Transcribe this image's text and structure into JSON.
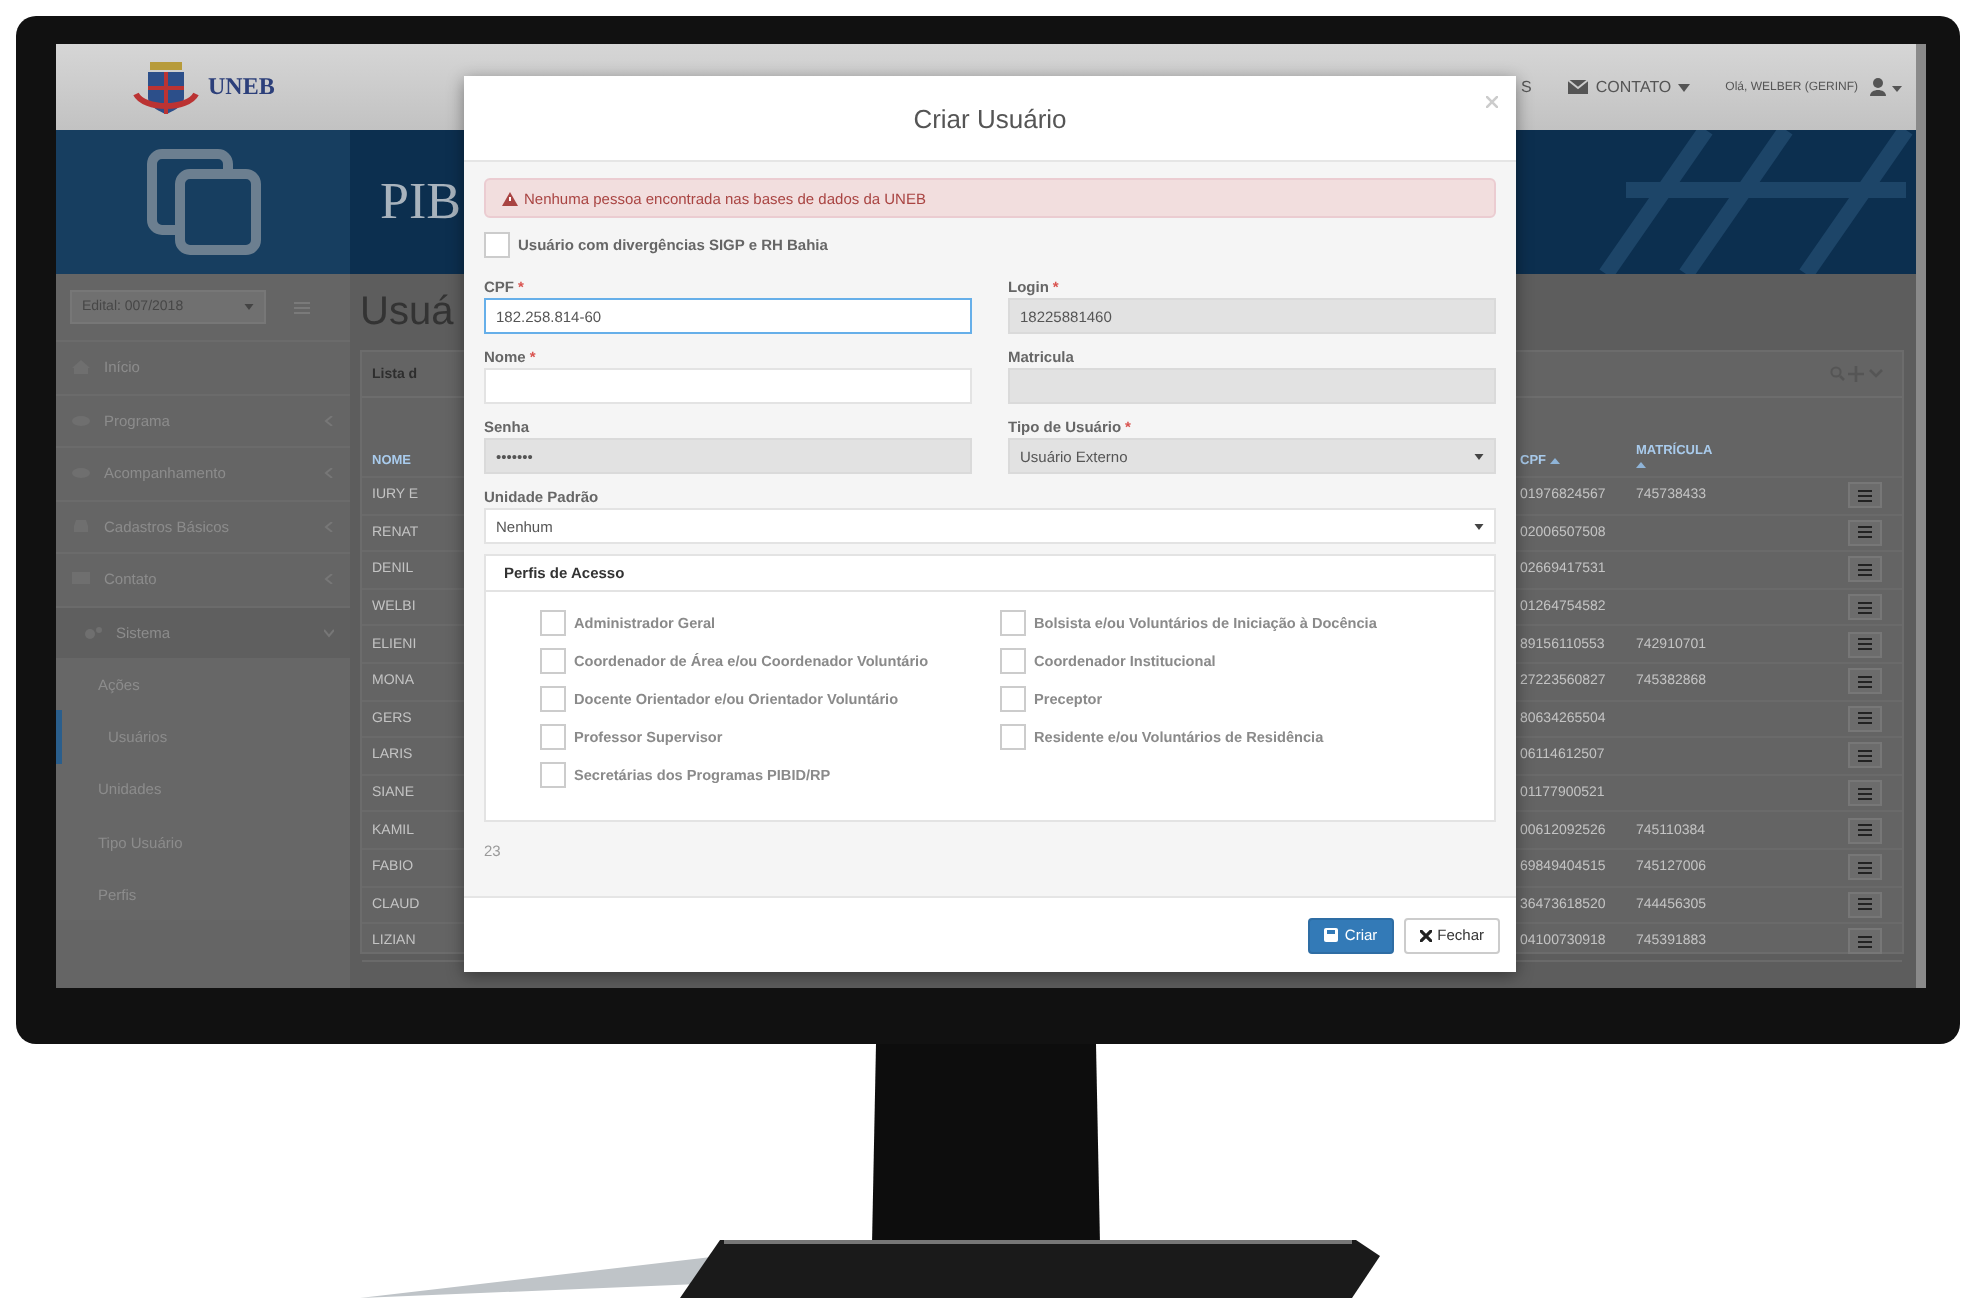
{
  "header": {
    "logo_text": "UNEB",
    "nav": [
      {
        "label": "S",
        "caret": false
      },
      {
        "label": "CONTATO",
        "caret": true
      }
    ],
    "user_greeting": "Olá, WELBER (GERINF)"
  },
  "banner": {
    "title": "PIB"
  },
  "sidebar": {
    "edital": "Edital: 007/2018",
    "items": [
      {
        "label": "Início",
        "kind": "link"
      },
      {
        "label": "Programa",
        "kind": "menu",
        "expanded": false
      },
      {
        "label": "Acompanhamento",
        "kind": "menu",
        "expanded": false
      },
      {
        "label": "Cadastros Básicos",
        "kind": "menu",
        "expanded": false
      },
      {
        "label": "Contato",
        "kind": "menu",
        "expanded": false
      },
      {
        "label": "Sistema",
        "kind": "menu",
        "expanded": true,
        "children": [
          {
            "label": "Ações",
            "selected": false
          },
          {
            "label": "Usuários",
            "selected": true
          },
          {
            "label": "Unidades",
            "selected": false
          },
          {
            "label": "Tipo Usuário",
            "selected": false
          },
          {
            "label": "Perfis",
            "selected": false
          }
        ]
      }
    ]
  },
  "main": {
    "title": "Usuá",
    "panel_title": "Lista d",
    "columns": [
      {
        "label": "NOME",
        "sortable": false
      },
      {
        "label": "CPF",
        "sortable": true
      },
      {
        "label": "MATRÍCULA",
        "sortable": true
      }
    ],
    "rows": [
      {
        "nome": "IURY E",
        "cpf": "01976824567",
        "matricula": "745738433"
      },
      {
        "nome": "RENAT",
        "cpf": "02006507508"
      },
      {
        "nome": "DENIL",
        "cpf": "02669417531"
      },
      {
        "nome": "WELBI",
        "cpf": "01264754582"
      },
      {
        "nome": "ELIENI",
        "cpf": "89156110553",
        "matricula": "742910701"
      },
      {
        "nome": "MONA",
        "cpf": "27223560827",
        "matricula": "745382868"
      },
      {
        "nome": "GERS",
        "cpf": "80634265504"
      },
      {
        "nome": "LARIS",
        "cpf": "06114612507"
      },
      {
        "nome": "SIANE",
        "cpf": "01177900521"
      },
      {
        "nome": "KAMIL",
        "cpf": "00612092526",
        "matricula": "745110384"
      },
      {
        "nome": "FABIO",
        "cpf": "69849404515",
        "matricula": "745127006"
      },
      {
        "nome": "CLAUD",
        "cpf": "36473618520",
        "matricula": "744456305"
      },
      {
        "nome": "LIZIAN",
        "cpf": "04100730918",
        "matricula": "745391883"
      }
    ]
  },
  "modal": {
    "title": "Criar Usuário",
    "alert": "Nenhuma pessoa encontrada nas bases de dados da UNEB",
    "divergence": {
      "label": "Usuário com divergências SIGP e RH Bahia",
      "checked": false
    },
    "fields": [
      {
        "label": "CPF",
        "required_mark": "*",
        "kind": "text",
        "value": "182.258.814-60",
        "focused": true,
        "disabled": false
      },
      {
        "label": "Login",
        "required_mark": "*",
        "kind": "text",
        "value": "18225881460",
        "focused": false,
        "disabled": true
      },
      {
        "label": "Nome",
        "required_mark": "*",
        "kind": "text",
        "focused": false,
        "disabled": false
      },
      {
        "label": "Matricula",
        "kind": "text",
        "focused": false,
        "disabled": true
      },
      {
        "label": "Senha",
        "kind": "text",
        "value": "•••••••",
        "focused": false,
        "disabled": true
      },
      {
        "label": "Tipo de Usuário",
        "required_mark": "*",
        "kind": "select",
        "value": "Usuário Externo",
        "focused": false,
        "disabled": true
      }
    ],
    "default_unit": {
      "label": "Unidade Padrão",
      "value": "Nenhum"
    },
    "profiles": {
      "title": "Perfis de Acesso",
      "items": [
        {
          "label": "Administrador Geral",
          "checked": false
        },
        {
          "label": "Bolsista e/ou Voluntários de Iniciação à Docência",
          "checked": false
        },
        {
          "label": "Coordenador de Área e/ou Coordenador Voluntário",
          "checked": false
        },
        {
          "label": "Coordenador Institucional",
          "checked": false
        },
        {
          "label": "Docente Orientador e/ou Orientador Voluntário",
          "checked": false
        },
        {
          "label": "Preceptor",
          "checked": false
        },
        {
          "label": "Professor Supervisor",
          "checked": false
        },
        {
          "label": "Residente e/ou Voluntários de Residência",
          "checked": false
        },
        {
          "label": "Secretárias dos Programas PIBID/RP",
          "checked": false
        }
      ]
    },
    "note": "23",
    "buttons": [
      {
        "label": "Criar",
        "kind": "primary"
      },
      {
        "label": "Fechar",
        "kind": "default"
      }
    ]
  }
}
